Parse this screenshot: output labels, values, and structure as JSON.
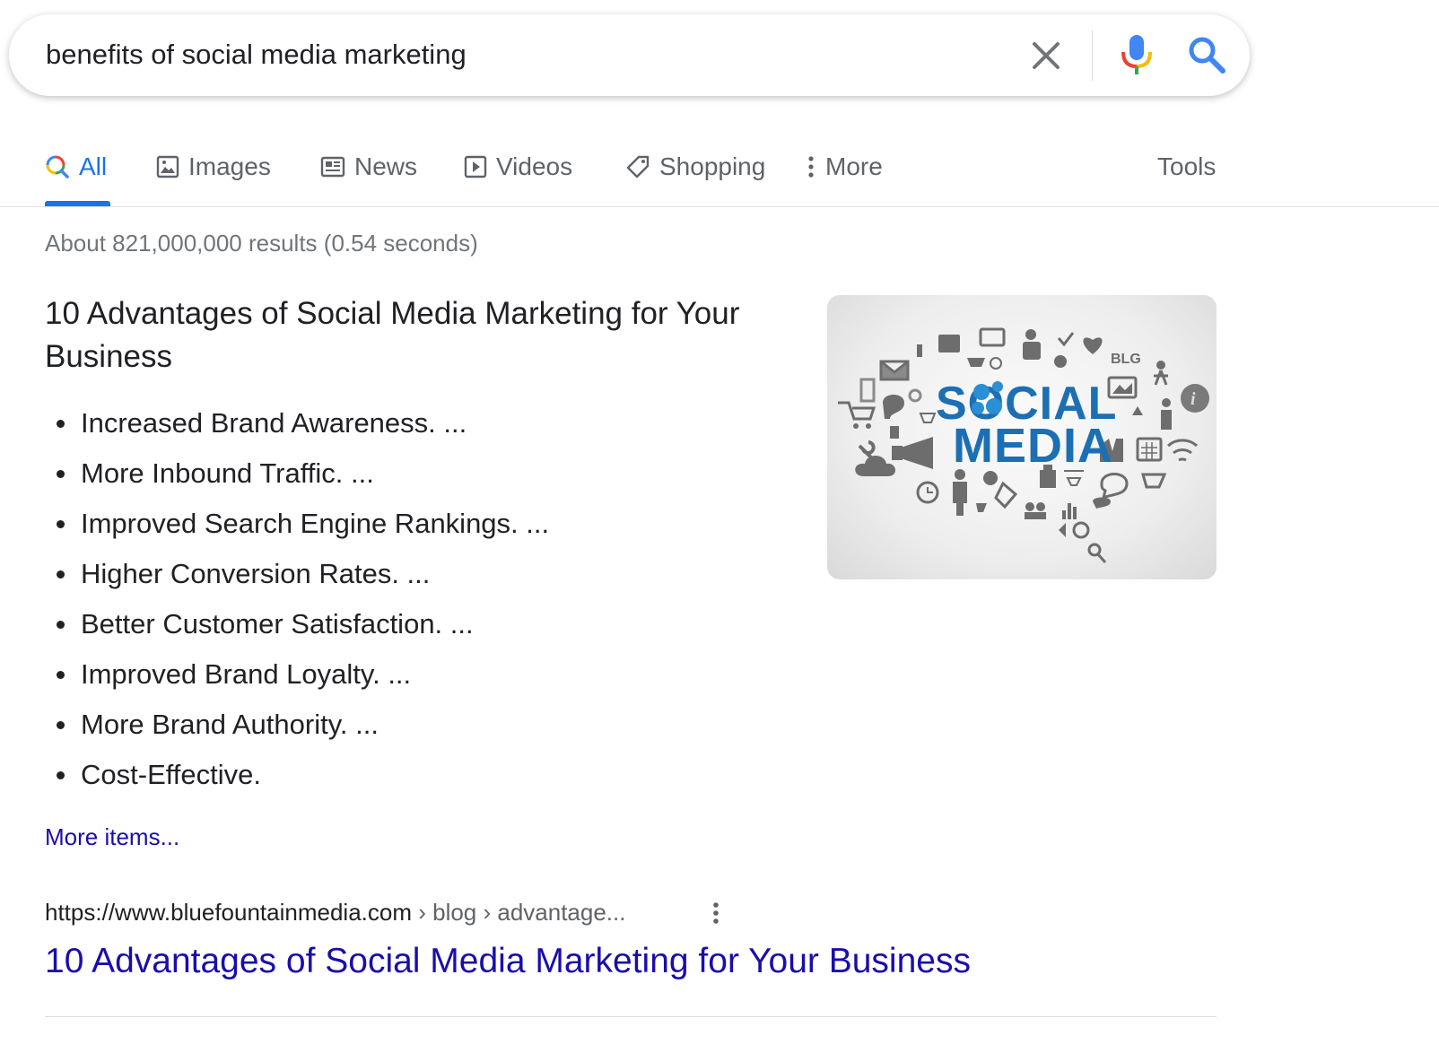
{
  "search": {
    "query": "benefits of social media marketing"
  },
  "tabs": [
    {
      "label": "All",
      "icon": "search-multicolor-icon",
      "active": true
    },
    {
      "label": "Images",
      "icon": "image-icon"
    },
    {
      "label": "News",
      "icon": "newspaper-icon"
    },
    {
      "label": "Videos",
      "icon": "play-box-icon"
    },
    {
      "label": "Shopping",
      "icon": "tag-icon"
    },
    {
      "label": "More",
      "icon": "vertical-dots-icon"
    }
  ],
  "tools_label": "Tools",
  "stats": "About 821,000,000 results (0.54 seconds)",
  "featured_snippet": {
    "title": "10 Advantages of Social Media Marketing for Your Business",
    "items": [
      "Increased Brand Awareness. ...",
      "More Inbound Traffic. ...",
      "Improved Search Engine Rankings. ...",
      "Higher Conversion Rates. ...",
      "Better Customer Satisfaction. ...",
      "Improved Brand Loyalty. ...",
      "More Brand Authority. ...",
      "Cost-Effective."
    ],
    "more_items": "More items...",
    "image": {
      "line1": "SOCIAL",
      "line2": "MEDIA"
    }
  },
  "source": {
    "domain": "https://www.bluefountainmedia.com",
    "path": " › blog › advantage...",
    "title": "10 Advantages of Social Media Marketing for Your Business"
  },
  "colors": {
    "link": "#1a0dab",
    "accent": "#1a73e8",
    "text": "#202124",
    "muted": "#70757a",
    "image_text": "#1c6fb3"
  }
}
